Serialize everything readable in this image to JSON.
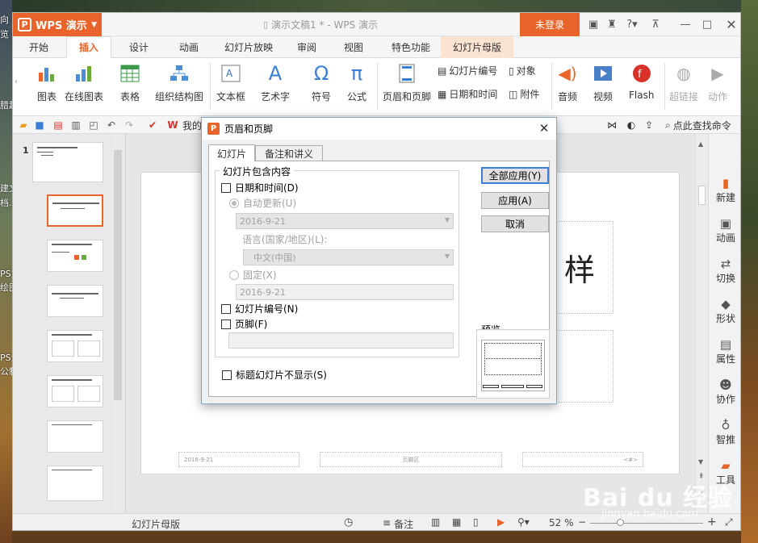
{
  "desktop": {
    "left_labels": [
      "向",
      "览",
      "腊超",
      "建文",
      "档.",
      "PS文",
      "绘图",
      "PS演",
      "公制"
    ]
  },
  "titlebar": {
    "app_name": "WPS 演示",
    "doc_title": "演示文稿1 * - WPS 演示",
    "login": "未登录"
  },
  "menu": {
    "tabs": [
      "开始",
      "插入",
      "设计",
      "动画",
      "幻灯片放映",
      "审阅",
      "视图",
      "特色功能",
      "幻灯片母版"
    ],
    "active": "插入"
  },
  "ribbon": {
    "items": [
      "图表",
      "在线图表",
      "表格",
      "组织结构图",
      "文本框",
      "艺术字",
      "符号",
      "公式",
      "页眉和页脚"
    ],
    "small_items": [
      "幻灯片编号",
      "对象",
      "日期和时间",
      "附件"
    ],
    "media": [
      "音频",
      "视频",
      "Flash",
      "超链接",
      "动作"
    ]
  },
  "qat": {
    "mine": "我的",
    "search": "点此查找命令"
  },
  "thumbs": {
    "first_number": "1"
  },
  "slide": {
    "title_partial": "样",
    "footer_date": "2016-9-21",
    "footer_center": "页脚区",
    "footer_num": "<#>"
  },
  "rightbar": {
    "items": [
      "新建",
      "动画",
      "切换",
      "形状",
      "属性",
      "协作",
      "智推",
      "工具"
    ]
  },
  "statusbar": {
    "left": "幻灯片母版",
    "notes": "备注",
    "zoom": "52 %"
  },
  "dialog": {
    "title": "页眉和页脚",
    "tabs": [
      "幻灯片",
      "备注和讲义"
    ],
    "group_label": "幻灯片包含内容",
    "date_time": "日期和时间(D)",
    "auto_update": "自动更新(U)",
    "date_value": "2016-9-21",
    "language_label": "语言(国家/地区)(L):",
    "language_value": "中文(中国)",
    "fixed": "固定(X)",
    "fixed_value": "2016-9-21",
    "slide_number": "幻灯片编号(N)",
    "footer": "页脚(F)",
    "footer_value": "",
    "hide_on_title": "标题幻灯片不显示(S)",
    "apply_all": "全部应用(Y)",
    "apply": "应用(A)",
    "cancel": "取消",
    "preview": "预览"
  },
  "watermark": {
    "logo": "Bai du 经验",
    "url": "jingyan.baidu.com"
  }
}
